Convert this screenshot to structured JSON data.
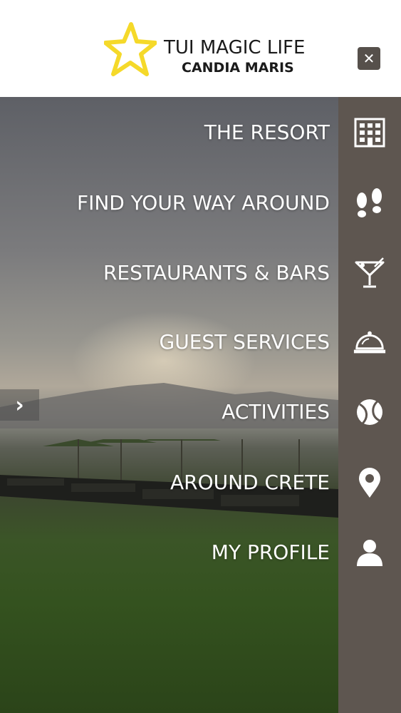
{
  "header": {
    "brand_line1": "TUI MAGIC LIFE",
    "brand_line2": "CANDIA MARIS",
    "close_icon": "close-icon",
    "close_glyph": "✕"
  },
  "hero": {
    "next_glyph": "›"
  },
  "menu": {
    "items": [
      {
        "label": "THE RESORT",
        "icon": "building-icon"
      },
      {
        "label": "FIND YOUR WAY AROUND",
        "icon": "footprints-icon"
      },
      {
        "label": "RESTAURANTS & BARS",
        "icon": "cocktail-icon"
      },
      {
        "label": "GUEST SERVICES",
        "icon": "service-bell-icon"
      },
      {
        "label": "ACTIVITIES",
        "icon": "tennis-ball-icon"
      },
      {
        "label": "AROUND CRETE",
        "icon": "map-pin-icon"
      },
      {
        "label": "MY PROFILE",
        "icon": "user-icon"
      }
    ]
  },
  "colors": {
    "rail": "#5e5650",
    "logo_star": "#f5d92a",
    "close_button": "#56504b"
  }
}
